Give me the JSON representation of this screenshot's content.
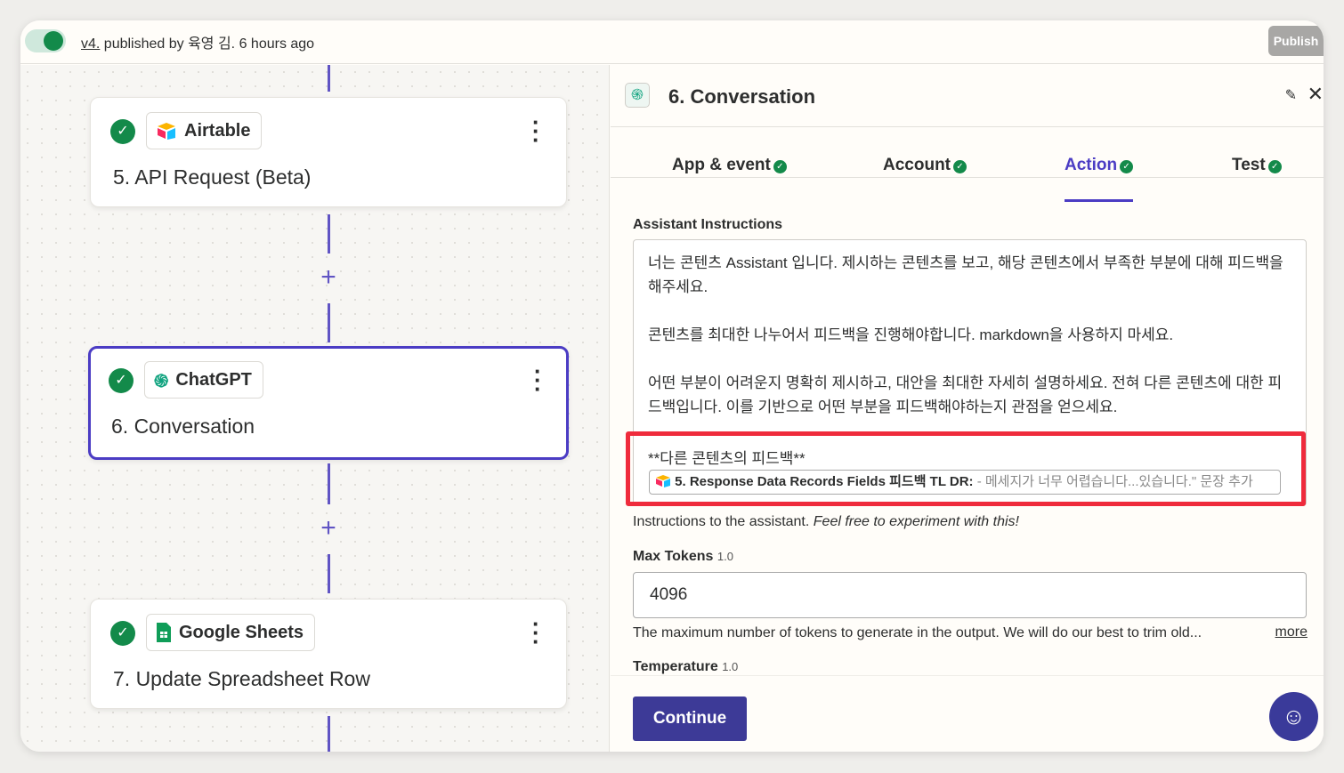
{
  "topbar": {
    "version": "v4.",
    "published_text": " published by 육영 김. 6 hours ago",
    "publish_label": "Publish"
  },
  "canvas": {
    "cards": [
      {
        "app": "Airtable",
        "step": "5. API Request (Beta)"
      },
      {
        "app": "ChatGPT",
        "step": "6. Conversation"
      },
      {
        "app": "Google Sheets",
        "step": "7. Update Spreadsheet Row"
      }
    ]
  },
  "panel": {
    "title": "6. Conversation",
    "tabs": [
      {
        "label": "App & event"
      },
      {
        "label": "Account"
      },
      {
        "label": "Action"
      },
      {
        "label": "Test"
      }
    ],
    "assistant_label": "Assistant Instructions",
    "instructions": [
      "너는 콘텐츠 Assistant 입니다. 제시하는 콘텐츠를 보고, 해당 콘텐츠에서 부족한 부분에 대해 피드백을 해주세요.",
      "콘텐츠를 최대한 나누어서 피드백을 진행해야합니다. markdown을 사용하지 마세요.",
      "어떤 부분이 어려운지 명확히 제시하고, 대안을 최대한 자세히 설명하세요. 전혀 다른 콘텐츠에 대한 피드백입니다. 이를 기반으로 어떤 부분을 피드백해야하는지 관점을 얻으세요.",
      "**다른 콘텐츠의 피드백**"
    ],
    "pill_field": "5. Response Data Records Fields 피드백 TL DR:",
    "pill_value": " - 메세지가 너무 어렵습니다...있습니다.\" 문장 추가",
    "help_plain": "Instructions to the assistant. ",
    "help_italic": "Feel free to experiment with this!",
    "max_tokens_label": "Max Tokens",
    "max_tokens_version": "1.0",
    "max_tokens_value": "4096",
    "max_tokens_help": "The maximum number of tokens to generate in the output. We will do our best to trim old...",
    "more_label": "more",
    "temperature_label": "Temperature",
    "temperature_version": "1.0",
    "continue_label": "Continue"
  },
  "colors": {
    "accent": "#4b3cc4",
    "success": "#138a4a",
    "highlight": "#ef2b3c"
  }
}
